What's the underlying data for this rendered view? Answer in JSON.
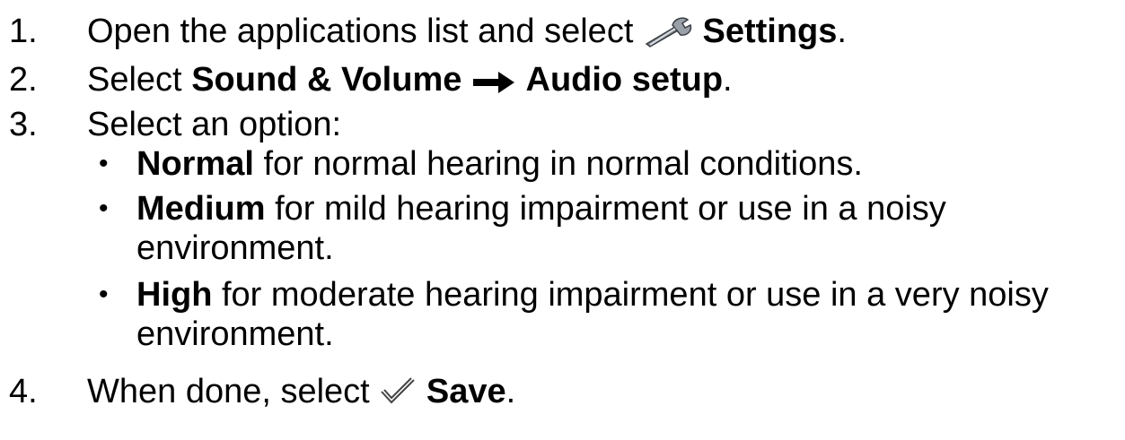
{
  "steps": [
    {
      "number": "1.",
      "pre": "Open the applications list and select",
      "icon": "wrench-icon",
      "bold": "Settings",
      "post": "."
    },
    {
      "number": "2.",
      "pre": "Select",
      "bold1": "Sound & Volume",
      "icon": "arrow-right-icon",
      "bold2": "Audio setup",
      "post": "."
    },
    {
      "number": "3.",
      "text": "Select an option:",
      "options": [
        {
          "bold": "Normal",
          "text": " for normal hearing in normal conditions."
        },
        {
          "bold": "Medium",
          "text": " for mild hearing impairment or use in a noisy",
          "cont": "environment."
        },
        {
          "bold": "High",
          "text": " for moderate hearing impairment or use in a very noisy",
          "cont": "environment."
        }
      ]
    },
    {
      "number": "4.",
      "pre": "When done, select",
      "icon": "checkmark-icon",
      "bold": "Save",
      "post": "."
    }
  ],
  "bullet_char": "•"
}
